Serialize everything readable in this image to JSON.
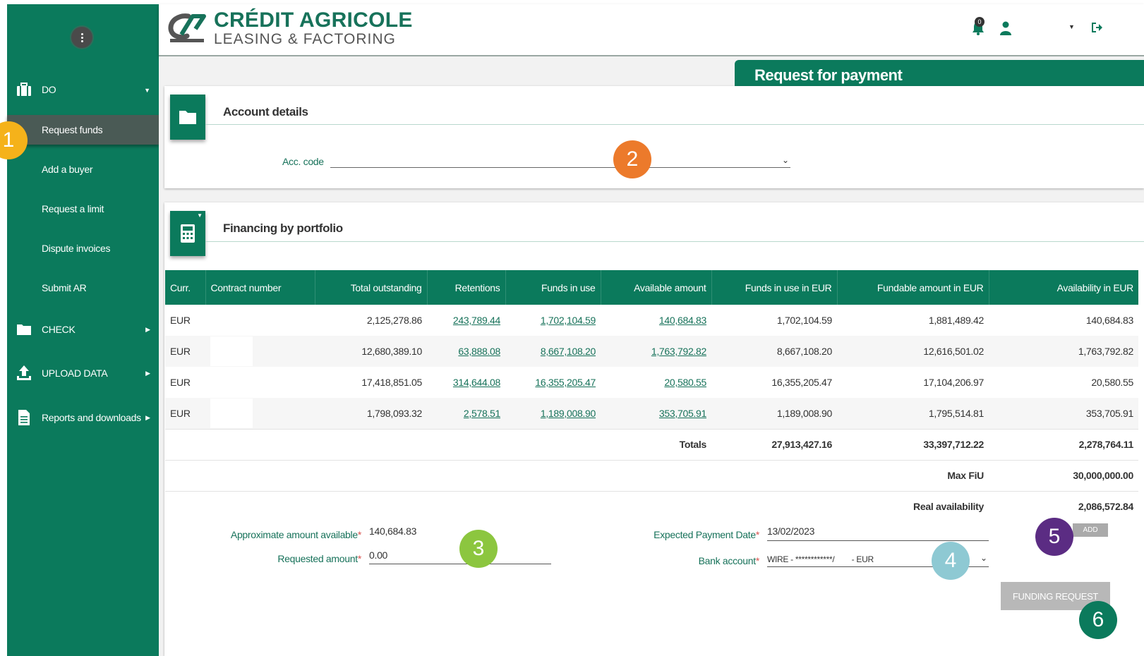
{
  "header": {
    "logo_line1": "CRÉDIT AGRICOLE",
    "logo_line2": "LEASING & FACTORING",
    "notification_count": "0"
  },
  "sidebar": {
    "do_label": "DO",
    "sub_items": [
      "Request funds",
      "Add a buyer",
      "Request a limit",
      "Dispute invoices",
      "Submit AR"
    ],
    "check_label": "CHECK",
    "upload_label": "UPLOAD DATA",
    "reports_label": "Reports and downloads"
  },
  "page": {
    "title": "Request for payment"
  },
  "account": {
    "title": "Account details",
    "acc_label": "Acc. code"
  },
  "financing": {
    "title": "Financing by portfolio",
    "columns": [
      "Curr.",
      "Contract number",
      "Total outstanding",
      "Retentions",
      "Funds in use",
      "Available amount",
      "Funds in use in EUR",
      "Fundable amount in EUR",
      "Availability in EUR"
    ],
    "rows": [
      {
        "curr": "EUR",
        "contract": "",
        "total": "2,125,278.86",
        "retentions": "243,789.44",
        "funds": "1,702,104.59",
        "available": "140,684.83",
        "funds_eur": "1,702,104.59",
        "fundable_eur": "1,881,489.42",
        "avail_eur": "140,684.83"
      },
      {
        "curr": "EUR",
        "contract": "",
        "total": "12,680,389.10",
        "retentions": "63,888.08",
        "funds": "8,667,108.20",
        "available": "1,763,792.82",
        "funds_eur": "8,667,108.20",
        "fundable_eur": "12,616,501.02",
        "avail_eur": "1,763,792.82"
      },
      {
        "curr": "EUR",
        "contract": "",
        "total": "17,418,851.05",
        "retentions": "314,644.08",
        "funds": "16,355,205.47",
        "available": "20,580.55",
        "funds_eur": "16,355,205.47",
        "fundable_eur": "17,104,206.97",
        "avail_eur": "20,580.55"
      },
      {
        "curr": "EUR",
        "contract": "",
        "total": "1,798,093.32",
        "retentions": "2,578.51",
        "funds": "1,189,008.90",
        "available": "353,705.91",
        "funds_eur": "1,189,008.90",
        "fundable_eur": "1,795,514.81",
        "avail_eur": "353,705.91"
      }
    ],
    "totals_label": "Totals",
    "totals_funds_eur": "27,913,427.16",
    "totals_fundable_eur": "33,397,712.22",
    "totals_avail_eur": "2,278,764.11",
    "max_fiu_label": "Max FiU",
    "max_fiu": "30,000,000.00",
    "real_avail_label": "Real availability",
    "real_avail": "2,086,572.84"
  },
  "form": {
    "approx_label": "Approximate amount available",
    "approx_value": "140,684.83",
    "requested_label": "Requested amount",
    "requested_value": "0.00",
    "date_label": "Expected Payment Date",
    "date_value": "13/02/2023",
    "bank_label": "Bank account",
    "bank_value": "WIRE - ************/        - EUR",
    "required_mark": "*",
    "add_button": "ADD",
    "funding_button": "FUNDING REQUEST"
  },
  "callouts": {
    "c1": "1",
    "c2": "2",
    "c3": "3",
    "c4": "4",
    "c5": "5",
    "c6": "6",
    "colors": {
      "c1": "#f5b21a",
      "c2": "#ec7a2b",
      "c3": "#8cc63f",
      "c4": "#8ec9d3",
      "c5": "#5b2c83",
      "c6": "#0b7a5c"
    }
  },
  "colors": {
    "primary": "#0b7a5c",
    "link": "#17725a"
  }
}
